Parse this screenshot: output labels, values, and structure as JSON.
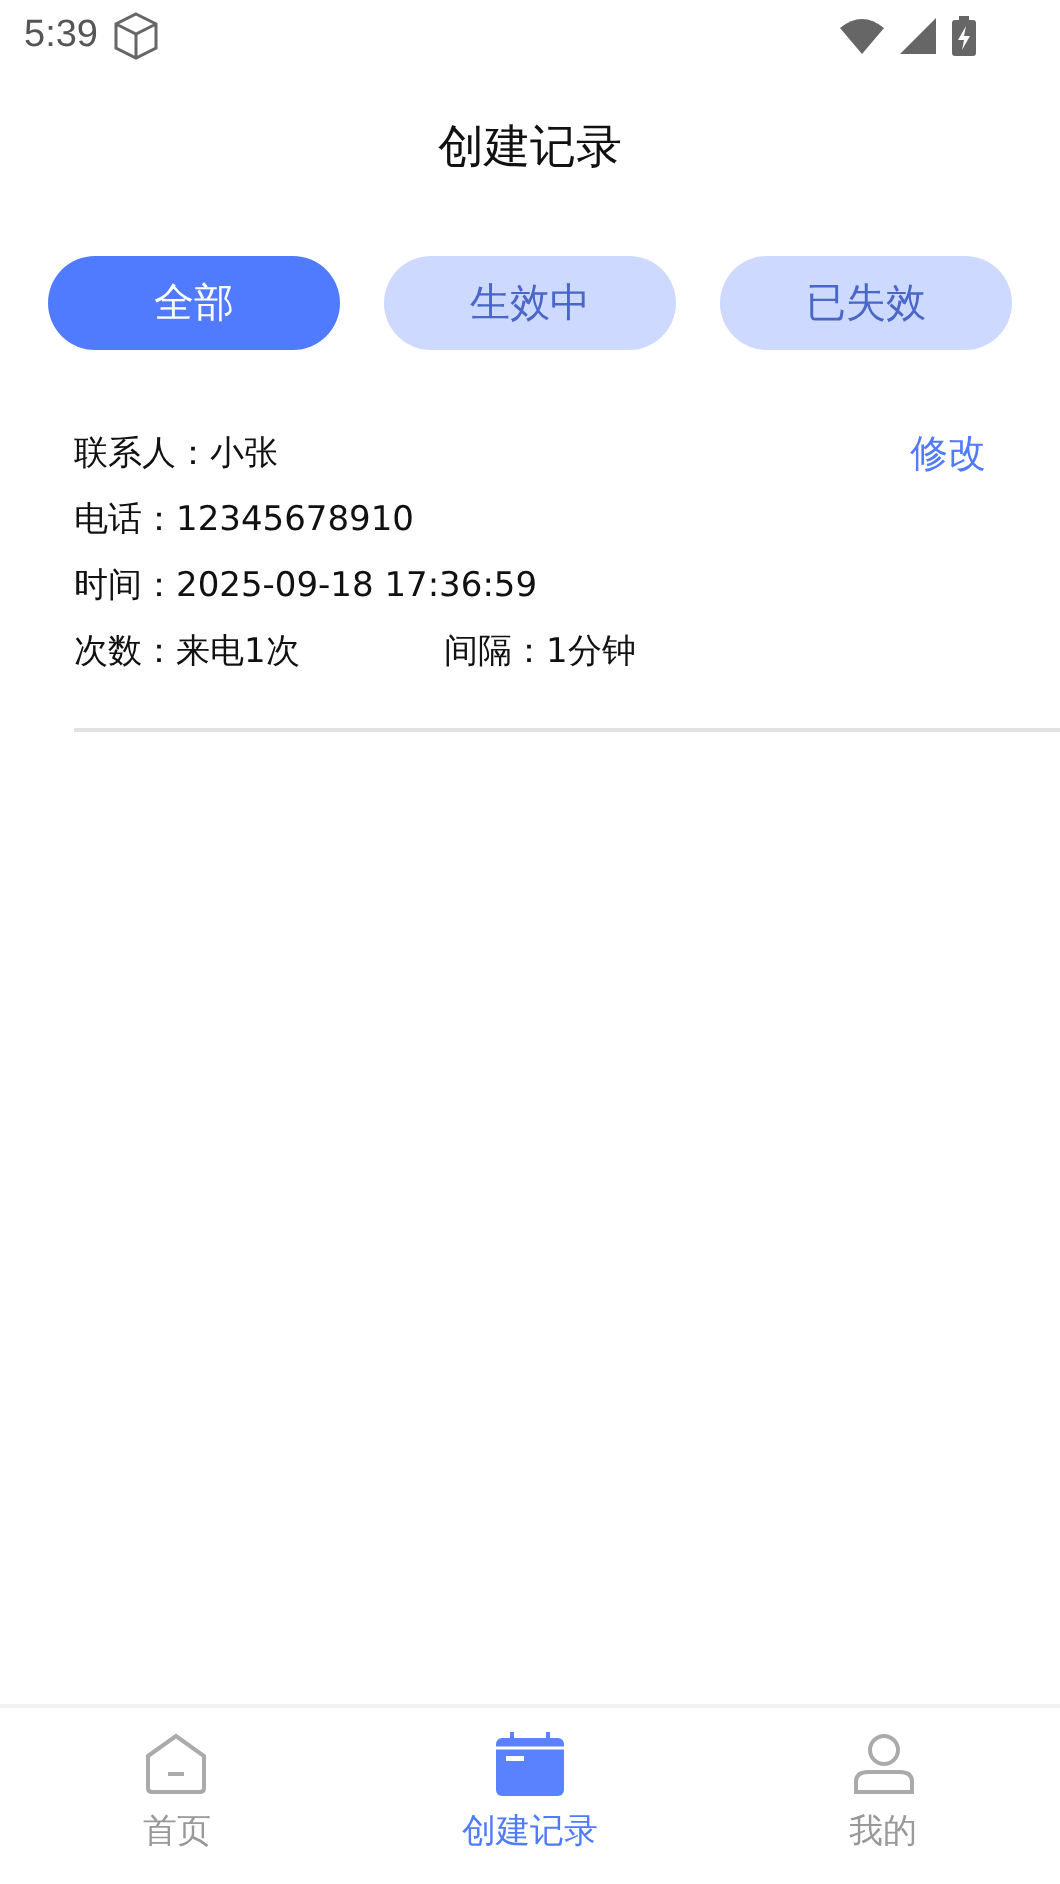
{
  "status_bar": {
    "time": "5:39"
  },
  "title": "创建记录",
  "filters": [
    {
      "label": "全部",
      "selected": true
    },
    {
      "label": "生效中",
      "selected": false
    },
    {
      "label": "已失效",
      "selected": false
    }
  ],
  "records": [
    {
      "contact": "联系人：小张",
      "edit": "修改",
      "phone": "电话：12345678910",
      "time": "时间：2025-09-18 17:36:59",
      "count": "次数：来电1次",
      "interval": "间隔：1分钟"
    }
  ],
  "nav": [
    {
      "kind": "home",
      "label": "首页",
      "selected": false
    },
    {
      "kind": "calendar",
      "label": "创建记录",
      "selected": true
    },
    {
      "kind": "person",
      "label": "我的",
      "selected": false
    }
  ]
}
